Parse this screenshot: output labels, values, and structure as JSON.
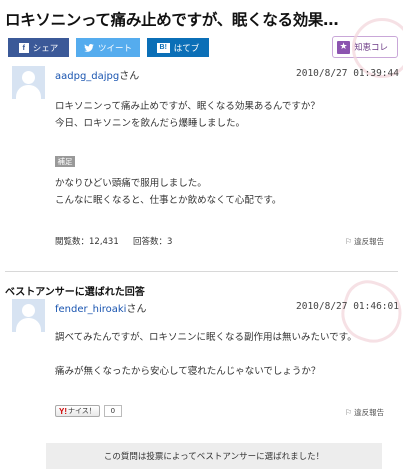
{
  "question": {
    "title": "ロキソニンって痛み止めですが、眠くなる効果…",
    "user_name": "aadpg_dajpg",
    "honorific": "さん",
    "date": "2010/8/27 01:39:44",
    "body_lines": [
      "ロキソニンって痛み止めですが、眠くなる効果あるんですか？",
      "今日、ロキソニンを飲んだら爆睡しました。"
    ],
    "supplement_badge": "補足",
    "supplement_lines": [
      "かなりひどい頭痛で服用しました。",
      "こんなに眠くなると、仕事とか飲めなくて心配です。"
    ],
    "views": "閲覧数：12,431",
    "answers": "回答数：3",
    "report_label": "違反報告"
  },
  "share": {
    "facebook_label": "シェア",
    "facebook_icon": "f",
    "twitter_label": "ツイート",
    "hatena_label": "はてブ",
    "hatena_icon": "B!"
  },
  "chie_button": {
    "label": "知恵コレ",
    "icon": "★"
  },
  "best_answer": {
    "header": "ベストアンサーに選ばれた回答",
    "user_name": "fender_hiroaki",
    "honorific": "さん",
    "date": "2010/8/27 01:46:01",
    "body_lines": [
      "調べてみたんですが、ロキソニンに眠くなる副作用は無いみたいです。",
      "痛みが無くなったから安心して寝れたんじゃないでしょうか？"
    ],
    "nice_y": "Y!",
    "nice_label": "ナイス！",
    "nice_count": "0",
    "report_label": "違反報告"
  },
  "footer": {
    "text": "この質問は投票によってベストアンサーに選ばれました！"
  }
}
